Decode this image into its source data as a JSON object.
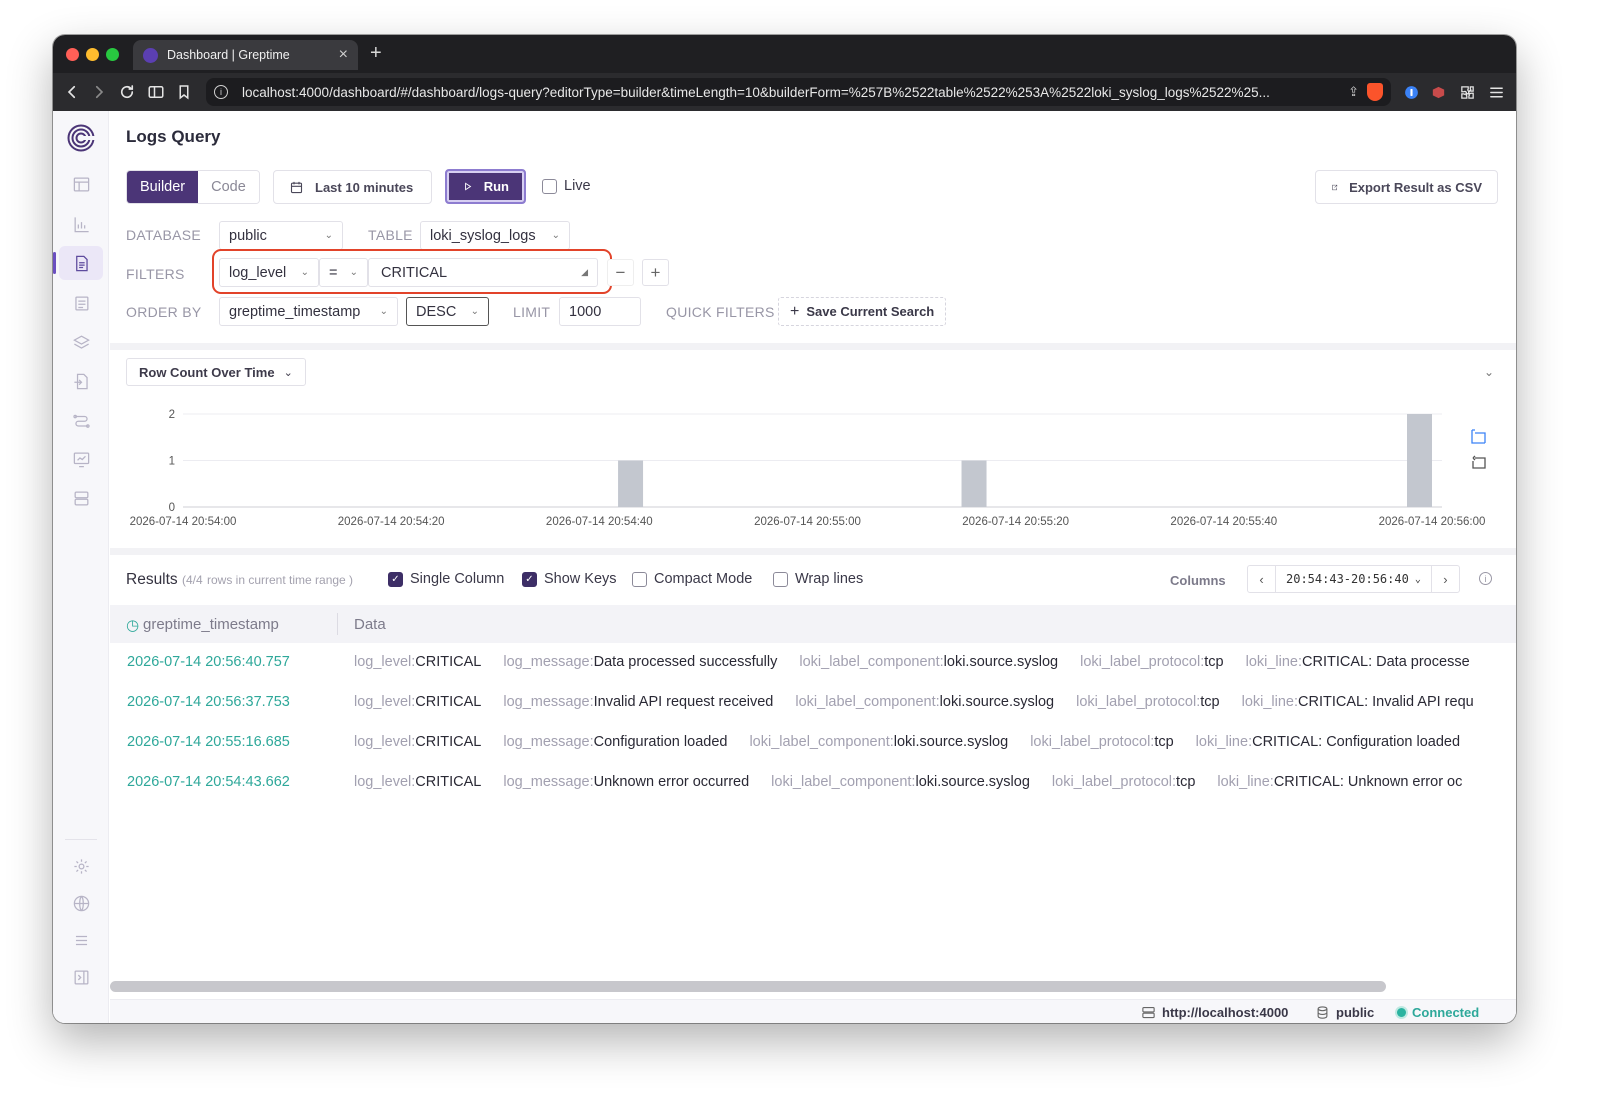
{
  "browser": {
    "tab_title": "Dashboard | Greptime",
    "tab_close": "×",
    "new_tab": "+",
    "url": "localhost:4000/dashboard/#/dashboard/logs-query?editorType=builder&timeLength=10&builderForm=%257B%2522table%2522%253A%2522loki_syslog_logs%2522%25..."
  },
  "sidebar": {
    "items": [
      {
        "icon": "table-icon",
        "active": false
      },
      {
        "icon": "chart-icon",
        "active": false
      },
      {
        "icon": "document-icon",
        "active": true
      },
      {
        "icon": "log-list-icon",
        "active": false
      },
      {
        "icon": "layers-icon",
        "active": false
      },
      {
        "icon": "import-icon",
        "active": false
      },
      {
        "icon": "pipeline-icon",
        "active": false
      },
      {
        "icon": "monitor-icon",
        "active": false
      },
      {
        "icon": "database-icon",
        "active": false
      }
    ],
    "bottom": [
      {
        "icon": "settings-icon"
      },
      {
        "icon": "globe-icon"
      },
      {
        "icon": "menu-icon"
      },
      {
        "icon": "collapse-sidebar-icon"
      }
    ]
  },
  "page": {
    "title": "Logs Query"
  },
  "toolbar": {
    "modes": [
      "Builder",
      "Code"
    ],
    "active_mode": "Builder",
    "time_range": "Last 10 minutes",
    "run": "Run",
    "live": "Live",
    "export": "Export Result as CSV"
  },
  "form": {
    "database_label": "DATABASE",
    "database": "public",
    "table_label": "TABLE",
    "table": "loki_syslog_logs",
    "filters_label": "FILTERS",
    "filter": {
      "field": "log_level",
      "op": "=",
      "value": "CRITICAL"
    },
    "filter_remove": "−",
    "filter_add": "+",
    "order_label": "ORDER BY",
    "order_field": "greptime_timestamp",
    "order_dir": "DESC",
    "limit_label": "LIMIT",
    "limit": "1000",
    "quick_filters_label": "QUICK FILTERS",
    "save_search": "Save Current Search"
  },
  "chart_panel": {
    "select": "Row Count Over Time"
  },
  "chart_data": {
    "type": "bar",
    "title": "",
    "x": [
      "2026-07-14 20:54:43",
      "2026-07-14 20:55:16",
      "2026-07-14 20:56:37"
    ],
    "values": [
      1,
      1,
      2
    ],
    "x_ticks": [
      "2026-07-14 20:54:00",
      "2026-07-14 20:54:20",
      "2026-07-14 20:54:40",
      "2026-07-14 20:55:00",
      "2026-07-14 20:55:20",
      "2026-07-14 20:55:40",
      "2026-07-14 20:56:00"
    ],
    "y_ticks": [
      "0",
      "1",
      "2"
    ],
    "ylim": [
      0,
      2
    ],
    "bar_color": "#c3c7cf",
    "grid": true
  },
  "results": {
    "title": "Results",
    "subtitle_count": "(4/4",
    "subtitle_text": "rows in current time range )",
    "options": [
      {
        "label": "Single Column",
        "checked": true
      },
      {
        "label": "Show Keys",
        "checked": true
      },
      {
        "label": "Compact Mode",
        "checked": false
      },
      {
        "label": "Wrap lines",
        "checked": false
      }
    ],
    "columns_label": "Columns",
    "range": "20:54:43-20:56:40",
    "headers": [
      "greptime_timestamp",
      "Data"
    ],
    "rows": [
      {
        "ts": "2026-07-14 20:56:40.757",
        "fields": [
          {
            "k": "log_level:",
            "v": "CRITICAL"
          },
          {
            "k": "log_message:",
            "v": "Data processed successfully"
          },
          {
            "k": "loki_label_component:",
            "v": "loki.source.syslog"
          },
          {
            "k": "loki_label_protocol:",
            "v": "tcp"
          },
          {
            "k": "loki_line:",
            "v": "CRITICAL: Data processe"
          }
        ]
      },
      {
        "ts": "2026-07-14 20:56:37.753",
        "fields": [
          {
            "k": "log_level:",
            "v": "CRITICAL"
          },
          {
            "k": "log_message:",
            "v": "Invalid API request received"
          },
          {
            "k": "loki_label_component:",
            "v": "loki.source.syslog"
          },
          {
            "k": "loki_label_protocol:",
            "v": "tcp"
          },
          {
            "k": "loki_line:",
            "v": "CRITICAL: Invalid API requ"
          }
        ]
      },
      {
        "ts": "2026-07-14 20:55:16.685",
        "fields": [
          {
            "k": "log_level:",
            "v": "CRITICAL"
          },
          {
            "k": "log_message:",
            "v": "Configuration loaded"
          },
          {
            "k": "loki_label_component:",
            "v": "loki.source.syslog"
          },
          {
            "k": "loki_label_protocol:",
            "v": "tcp"
          },
          {
            "k": "loki_line:",
            "v": "CRITICAL: Configuration loaded"
          }
        ]
      },
      {
        "ts": "2026-07-14 20:54:43.662",
        "fields": [
          {
            "k": "log_level:",
            "v": "CRITICAL"
          },
          {
            "k": "log_message:",
            "v": "Unknown error occurred"
          },
          {
            "k": "loki_label_component:",
            "v": "loki.source.syslog"
          },
          {
            "k": "loki_label_protocol:",
            "v": "tcp"
          },
          {
            "k": "loki_line:",
            "v": "CRITICAL: Unknown error oc"
          }
        ]
      }
    ]
  },
  "statusbar": {
    "host": "http://localhost:4000",
    "database": "public",
    "status": "Connected"
  },
  "colors": {
    "accent": "#4b3577",
    "highlight": "#e2432a",
    "timestamp": "#2ea89a"
  }
}
